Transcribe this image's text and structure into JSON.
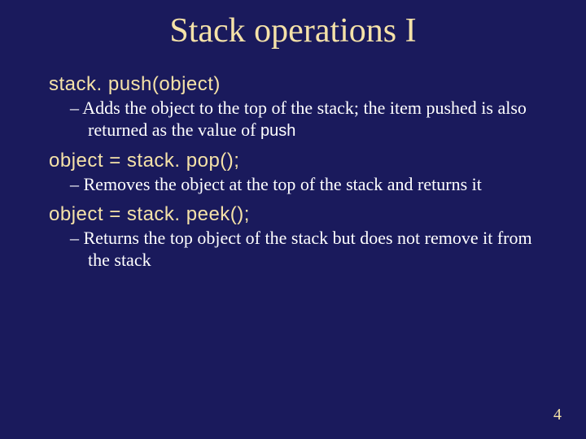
{
  "title": "Stack operations I",
  "ops": [
    {
      "signature": "stack. push(object)",
      "desc_pre": "Adds the object to the top of the stack; the item pushed is also returned as the value of ",
      "desc_code": "push",
      "desc_post": ""
    },
    {
      "signature": "object = stack. pop();",
      "desc_pre": "Removes the object at the top of the stack and returns it",
      "desc_code": "",
      "desc_post": ""
    },
    {
      "signature": "object = stack. peek();",
      "desc_pre": "Returns the top object of the stack but does not remove it from the stack",
      "desc_code": "",
      "desc_post": ""
    }
  ],
  "dash": "–  ",
  "page_number": "4"
}
